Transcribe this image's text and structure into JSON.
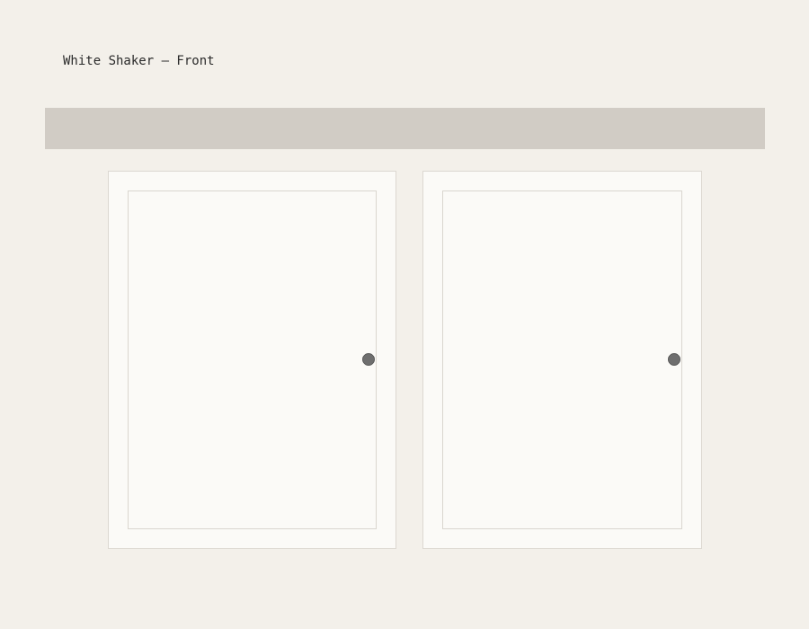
{
  "title": "White Shaker – Front",
  "cabinet": {
    "finish": "White Shaker",
    "view": "Front",
    "door_count": 2,
    "colors": {
      "background": "#f3f0ea",
      "countertop": "#d1ccc5",
      "door": "#fbfaf7",
      "door_outline": "#dcd8d1",
      "knob": "#6e6e6e"
    }
  }
}
